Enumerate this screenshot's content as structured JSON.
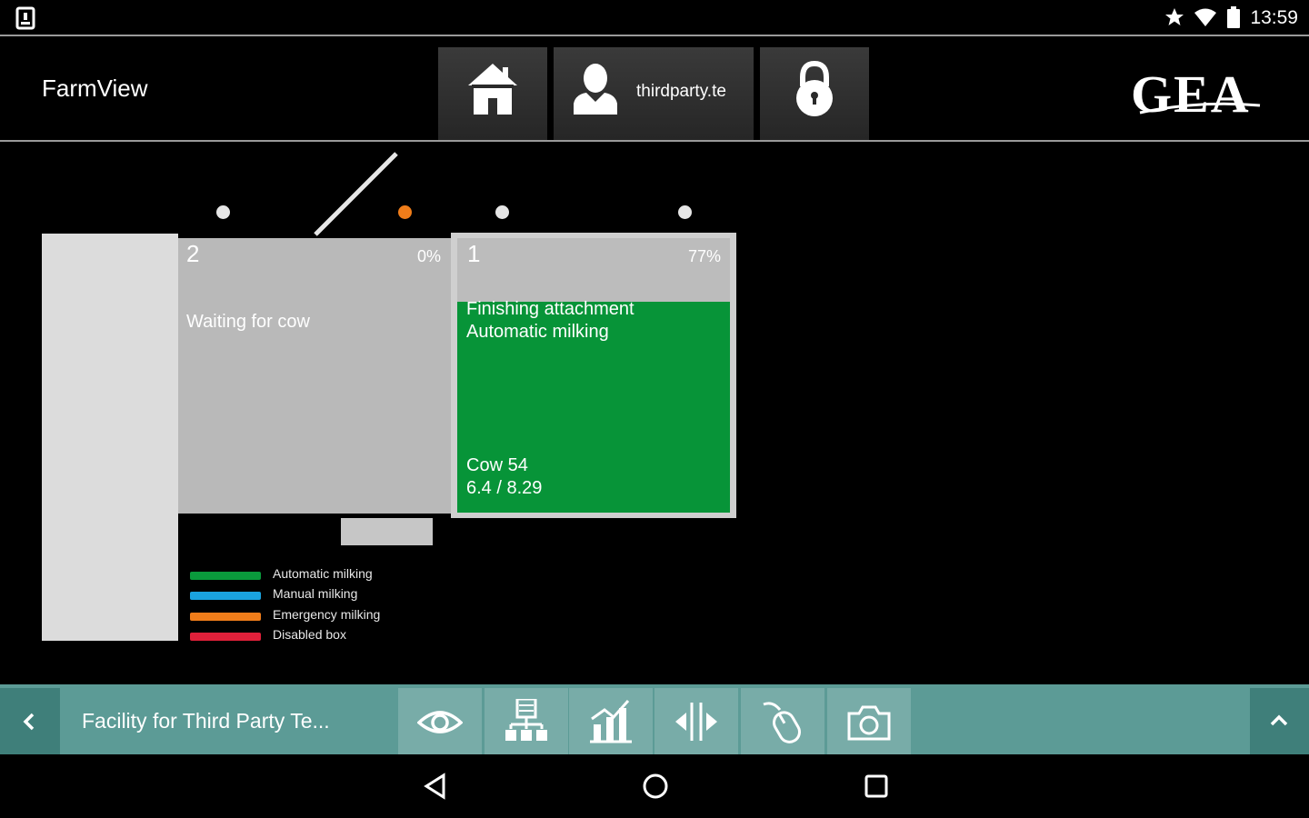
{
  "status_bar": {
    "time": "13:59",
    "icons": [
      "tablet-icon",
      "star-icon",
      "wifi-icon",
      "battery-icon"
    ]
  },
  "header": {
    "app_title": "FarmView",
    "user_name": "thirdparty.te",
    "brand": "GEA",
    "buttons": [
      "home-icon",
      "user-icon",
      "lock-icon"
    ]
  },
  "parlour": {
    "stalls": [
      {
        "number": "2",
        "percent": "0%",
        "status": "Waiting for cow"
      },
      {
        "number": "1",
        "percent": "77%",
        "status_line1": "Finishing attachment",
        "status_line2": "Automatic milking",
        "cow": "Cow 54",
        "yield": "6.4 / 8.29",
        "progress": 0.77,
        "color": "#079438"
      }
    ],
    "indicator_colors": [
      "#e6e6e6",
      "#f07d1a",
      "#e6e6e6",
      "#e6e6e6"
    ]
  },
  "legend": [
    {
      "label": "Automatic milking",
      "color": "#0a9a3c"
    },
    {
      "label": "Manual milking",
      "color": "#1aa3e0"
    },
    {
      "label": "Emergency milking",
      "color": "#f07d1a"
    },
    {
      "label": "Disabled box",
      "color": "#e0203a"
    }
  ],
  "toolbar": {
    "facility_title": "Facility for Third Party Te...",
    "buttons": [
      "eye-icon",
      "hierarchy-icon",
      "chart-icon",
      "split-icon",
      "mouse-icon",
      "camera-icon"
    ]
  },
  "colors": {
    "toolbar": "#5c9b96",
    "toolbar_dark": "#3f7f7a",
    "toolbar_button": "#78aca8"
  }
}
